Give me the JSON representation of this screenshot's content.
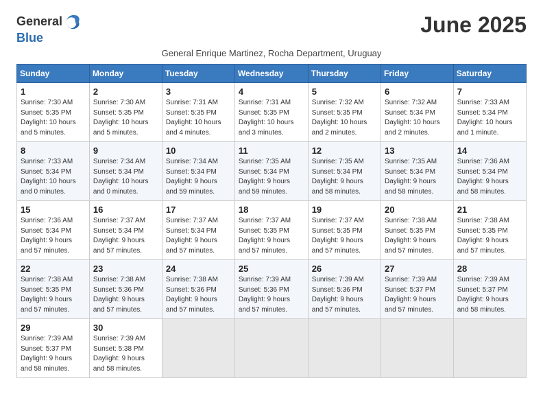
{
  "app": {
    "logo_general": "General",
    "logo_blue": "Blue"
  },
  "header": {
    "title": "June 2025",
    "subtitle": "General Enrique Martinez, Rocha Department, Uruguay"
  },
  "weekdays": [
    "Sunday",
    "Monday",
    "Tuesday",
    "Wednesday",
    "Thursday",
    "Friday",
    "Saturday"
  ],
  "weeks": [
    [
      {
        "day": "1",
        "sunrise": "Sunrise: 7:30 AM",
        "sunset": "Sunset: 5:35 PM",
        "daylight": "Daylight: 10 hours and 5 minutes."
      },
      {
        "day": "2",
        "sunrise": "Sunrise: 7:30 AM",
        "sunset": "Sunset: 5:35 PM",
        "daylight": "Daylight: 10 hours and 5 minutes."
      },
      {
        "day": "3",
        "sunrise": "Sunrise: 7:31 AM",
        "sunset": "Sunset: 5:35 PM",
        "daylight": "Daylight: 10 hours and 4 minutes."
      },
      {
        "day": "4",
        "sunrise": "Sunrise: 7:31 AM",
        "sunset": "Sunset: 5:35 PM",
        "daylight": "Daylight: 10 hours and 3 minutes."
      },
      {
        "day": "5",
        "sunrise": "Sunrise: 7:32 AM",
        "sunset": "Sunset: 5:35 PM",
        "daylight": "Daylight: 10 hours and 2 minutes."
      },
      {
        "day": "6",
        "sunrise": "Sunrise: 7:32 AM",
        "sunset": "Sunset: 5:34 PM",
        "daylight": "Daylight: 10 hours and 2 minutes."
      },
      {
        "day": "7",
        "sunrise": "Sunrise: 7:33 AM",
        "sunset": "Sunset: 5:34 PM",
        "daylight": "Daylight: 10 hours and 1 minute."
      }
    ],
    [
      {
        "day": "8",
        "sunrise": "Sunrise: 7:33 AM",
        "sunset": "Sunset: 5:34 PM",
        "daylight": "Daylight: 10 hours and 0 minutes."
      },
      {
        "day": "9",
        "sunrise": "Sunrise: 7:34 AM",
        "sunset": "Sunset: 5:34 PM",
        "daylight": "Daylight: 10 hours and 0 minutes."
      },
      {
        "day": "10",
        "sunrise": "Sunrise: 7:34 AM",
        "sunset": "Sunset: 5:34 PM",
        "daylight": "Daylight: 9 hours and 59 minutes."
      },
      {
        "day": "11",
        "sunrise": "Sunrise: 7:35 AM",
        "sunset": "Sunset: 5:34 PM",
        "daylight": "Daylight: 9 hours and 59 minutes."
      },
      {
        "day": "12",
        "sunrise": "Sunrise: 7:35 AM",
        "sunset": "Sunset: 5:34 PM",
        "daylight": "Daylight: 9 hours and 58 minutes."
      },
      {
        "day": "13",
        "sunrise": "Sunrise: 7:35 AM",
        "sunset": "Sunset: 5:34 PM",
        "daylight": "Daylight: 9 hours and 58 minutes."
      },
      {
        "day": "14",
        "sunrise": "Sunrise: 7:36 AM",
        "sunset": "Sunset: 5:34 PM",
        "daylight": "Daylight: 9 hours and 58 minutes."
      }
    ],
    [
      {
        "day": "15",
        "sunrise": "Sunrise: 7:36 AM",
        "sunset": "Sunset: 5:34 PM",
        "daylight": "Daylight: 9 hours and 57 minutes."
      },
      {
        "day": "16",
        "sunrise": "Sunrise: 7:37 AM",
        "sunset": "Sunset: 5:34 PM",
        "daylight": "Daylight: 9 hours and 57 minutes."
      },
      {
        "day": "17",
        "sunrise": "Sunrise: 7:37 AM",
        "sunset": "Sunset: 5:34 PM",
        "daylight": "Daylight: 9 hours and 57 minutes."
      },
      {
        "day": "18",
        "sunrise": "Sunrise: 7:37 AM",
        "sunset": "Sunset: 5:35 PM",
        "daylight": "Daylight: 9 hours and 57 minutes."
      },
      {
        "day": "19",
        "sunrise": "Sunrise: 7:37 AM",
        "sunset": "Sunset: 5:35 PM",
        "daylight": "Daylight: 9 hours and 57 minutes."
      },
      {
        "day": "20",
        "sunrise": "Sunrise: 7:38 AM",
        "sunset": "Sunset: 5:35 PM",
        "daylight": "Daylight: 9 hours and 57 minutes."
      },
      {
        "day": "21",
        "sunrise": "Sunrise: 7:38 AM",
        "sunset": "Sunset: 5:35 PM",
        "daylight": "Daylight: 9 hours and 57 minutes."
      }
    ],
    [
      {
        "day": "22",
        "sunrise": "Sunrise: 7:38 AM",
        "sunset": "Sunset: 5:35 PM",
        "daylight": "Daylight: 9 hours and 57 minutes."
      },
      {
        "day": "23",
        "sunrise": "Sunrise: 7:38 AM",
        "sunset": "Sunset: 5:36 PM",
        "daylight": "Daylight: 9 hours and 57 minutes."
      },
      {
        "day": "24",
        "sunrise": "Sunrise: 7:38 AM",
        "sunset": "Sunset: 5:36 PM",
        "daylight": "Daylight: 9 hours and 57 minutes."
      },
      {
        "day": "25",
        "sunrise": "Sunrise: 7:39 AM",
        "sunset": "Sunset: 5:36 PM",
        "daylight": "Daylight: 9 hours and 57 minutes."
      },
      {
        "day": "26",
        "sunrise": "Sunrise: 7:39 AM",
        "sunset": "Sunset: 5:36 PM",
        "daylight": "Daylight: 9 hours and 57 minutes."
      },
      {
        "day": "27",
        "sunrise": "Sunrise: 7:39 AM",
        "sunset": "Sunset: 5:37 PM",
        "daylight": "Daylight: 9 hours and 57 minutes."
      },
      {
        "day": "28",
        "sunrise": "Sunrise: 7:39 AM",
        "sunset": "Sunset: 5:37 PM",
        "daylight": "Daylight: 9 hours and 58 minutes."
      }
    ],
    [
      {
        "day": "29",
        "sunrise": "Sunrise: 7:39 AM",
        "sunset": "Sunset: 5:37 PM",
        "daylight": "Daylight: 9 hours and 58 minutes."
      },
      {
        "day": "30",
        "sunrise": "Sunrise: 7:39 AM",
        "sunset": "Sunset: 5:38 PM",
        "daylight": "Daylight: 9 hours and 58 minutes."
      },
      null,
      null,
      null,
      null,
      null
    ]
  ]
}
